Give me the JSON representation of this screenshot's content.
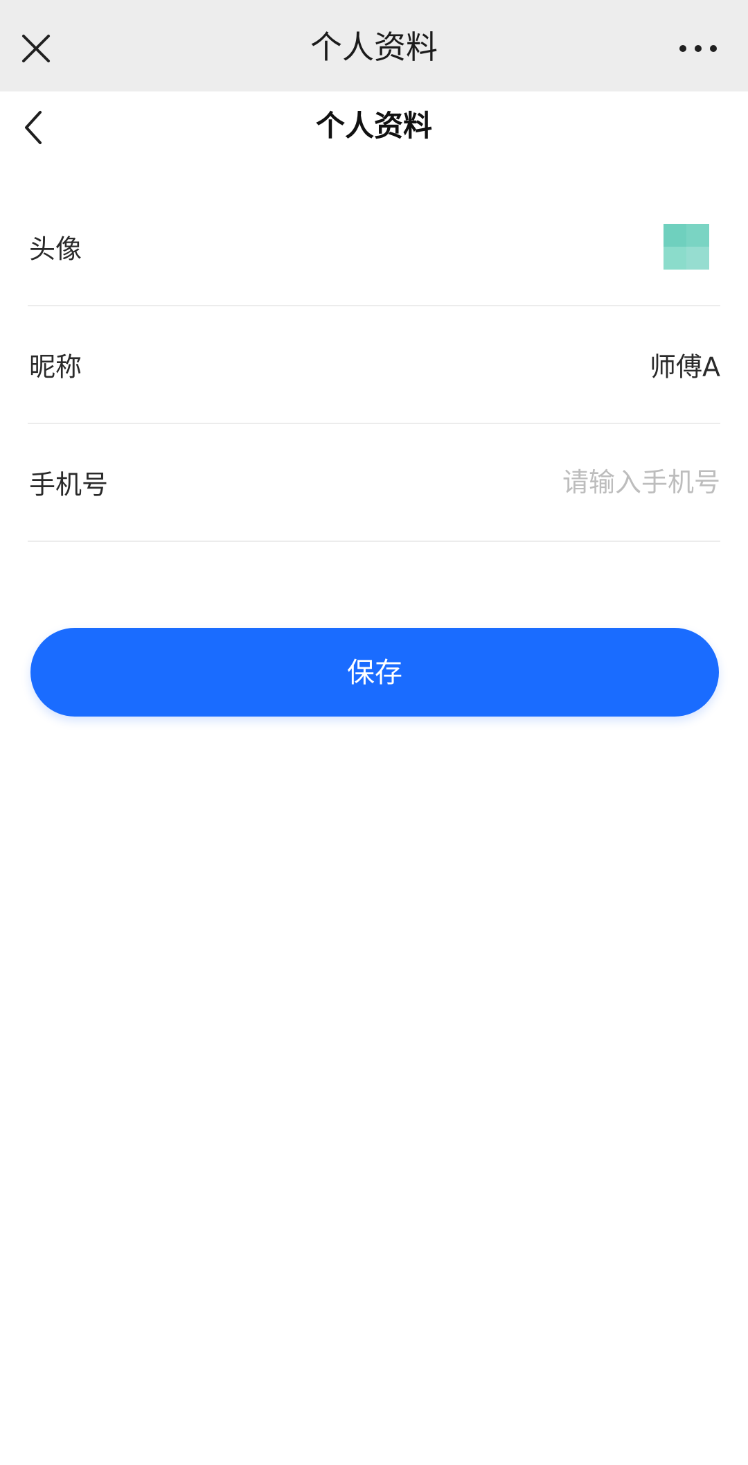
{
  "window": {
    "title": "个人资料"
  },
  "nav": {
    "title": "个人资料"
  },
  "form": {
    "avatar_label": "头像",
    "nickname_label": "昵称",
    "nickname_value": "师傅A",
    "phone_label": "手机号",
    "phone_value": "",
    "phone_placeholder": "请输入手机号"
  },
  "actions": {
    "save_label": "保存"
  },
  "colors": {
    "top_bar_bg": "#ededed",
    "primary": "#1a6cff",
    "divider": "#ececec",
    "placeholder": "#bdbdbd",
    "avatar_tiles": [
      "#6fd0be",
      "#7ad4c3",
      "#8bdccb",
      "#96ddd0"
    ]
  },
  "icons": {
    "close": "close-icon",
    "more": "more-icon",
    "back": "back-icon"
  }
}
